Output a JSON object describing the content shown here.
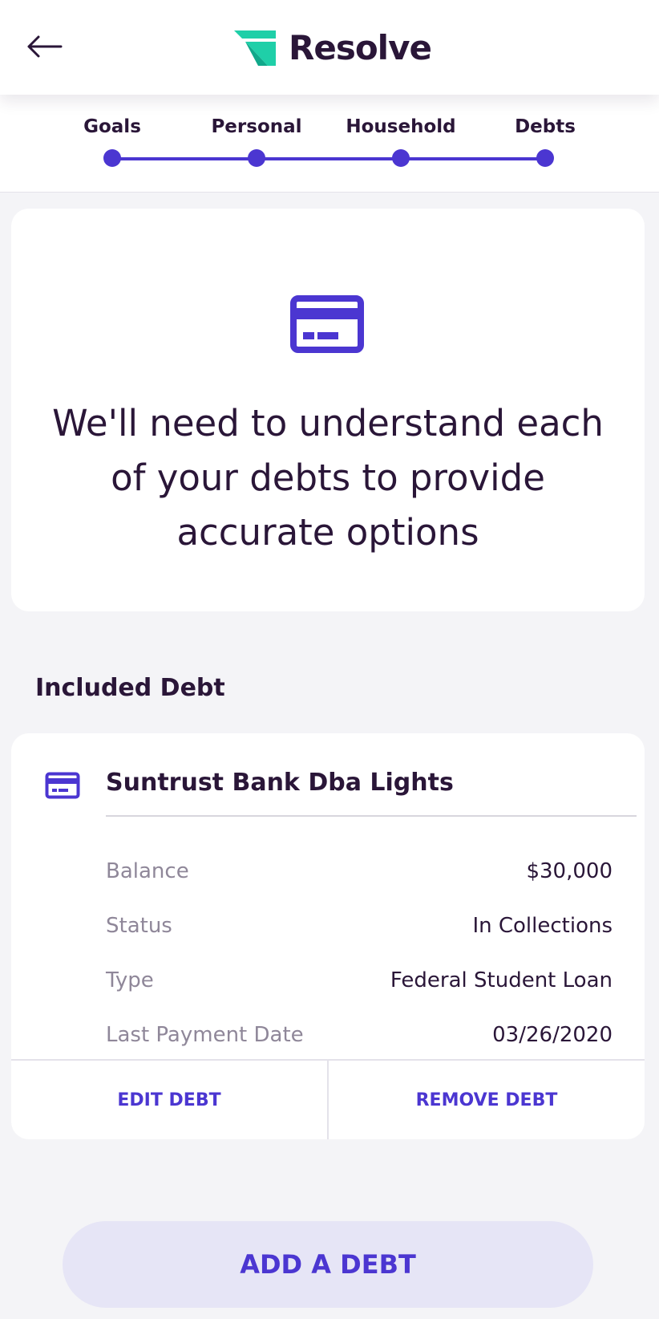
{
  "app": {
    "brand_name": "Resolve",
    "colors": {
      "accent": "#4b36d1",
      "text": "#2a1638",
      "muted": "#8f8799",
      "logo_teal": "#1fcfa8",
      "logo_teal_dark": "#10a88a",
      "background": "#f4f4f7",
      "button_bg": "#e6e5f6"
    }
  },
  "header": {
    "back_icon": "arrow-left-icon"
  },
  "stepper": {
    "steps": [
      {
        "label": "Goals",
        "completed": true
      },
      {
        "label": "Personal",
        "completed": true
      },
      {
        "label": "Household",
        "completed": true
      },
      {
        "label": "Debts",
        "completed": true
      }
    ]
  },
  "intro": {
    "icon": "credit-card-icon",
    "text": "We'll need to understand each of your debts to provide accurate options"
  },
  "included_debt": {
    "title": "Included Debt",
    "debt": {
      "icon": "credit-card-icon",
      "name": "Suntrust Bank Dba Lights",
      "details": [
        {
          "label": "Balance",
          "value": "$30,000"
        },
        {
          "label": "Status",
          "value": "In Collections"
        },
        {
          "label": "Type",
          "value": "Federal Student Loan"
        },
        {
          "label": "Last Payment Date",
          "value": "03/26/2020"
        }
      ],
      "edit_label": "EDIT DEBT",
      "remove_label": "REMOVE DEBT"
    }
  },
  "footer": {
    "add_debt_label": "ADD A DEBT"
  }
}
